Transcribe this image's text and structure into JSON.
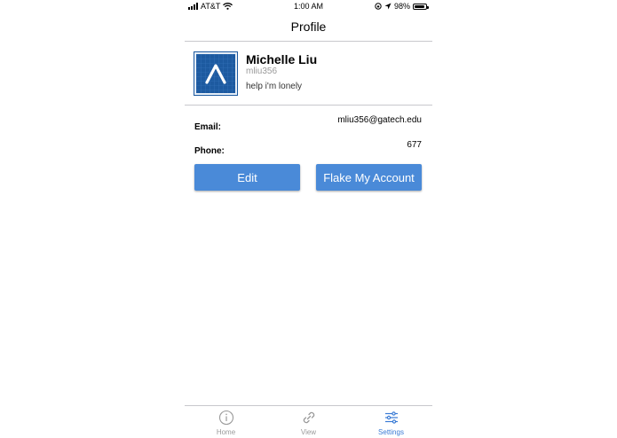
{
  "status_bar": {
    "carrier": "AT&T",
    "time": "1:00 AM",
    "battery": "98%",
    "icons": [
      "signal-icon",
      "wifi-icon",
      "orientation-lock-icon",
      "location-icon",
      "battery-icon"
    ]
  },
  "nav": {
    "title": "Profile"
  },
  "profile": {
    "name": "Michelle Liu",
    "username": "mliu356",
    "bio": "help i'm lonely",
    "avatar_icon": "caret-logo-icon"
  },
  "details": {
    "email_label": "Email:",
    "email_value": "mliu356@gatech.edu",
    "phone_label": "Phone:",
    "phone_value": "677"
  },
  "buttons": {
    "edit": "Edit",
    "flake": "Flake My Account"
  },
  "tabbar": {
    "tabs": [
      {
        "label": "Home",
        "icon": "info-icon",
        "active": false
      },
      {
        "label": "View",
        "icon": "link-icon",
        "active": false
      },
      {
        "label": "Settings",
        "icon": "sliders-icon",
        "active": true
      }
    ]
  },
  "colors": {
    "accent": "#4a8ad8",
    "active_tab": "#3a7bd5",
    "inactive_tab": "#9a9a9a",
    "avatar_bg": "#1d5aa0"
  }
}
